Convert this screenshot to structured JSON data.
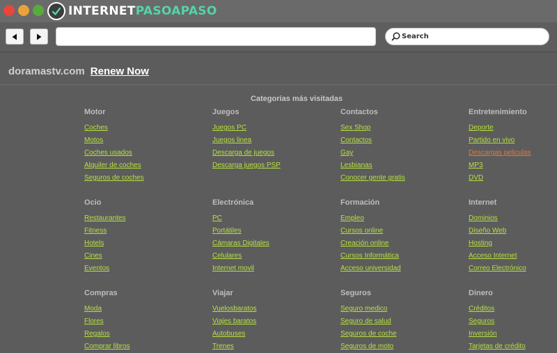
{
  "browser": {
    "brand_main": "INTERNET",
    "brand_accent": "PASOAPASO",
    "address_value": "",
    "search_placeholder": "Search"
  },
  "page": {
    "domain": "doramastv.com",
    "renew_label": "Renew Now",
    "categories_title": "Categorías más visitadas"
  },
  "colors": {
    "page_background": "#5c5c5c",
    "link": "#b7e23f",
    "link_visited": "#e07a3e",
    "heading": "#bdbdbd",
    "brand_accent": "#55d3a8",
    "traffic_red": "#e8453c",
    "traffic_yellow": "#e9a23b",
    "traffic_green": "#5aab3e"
  },
  "categories": [
    {
      "heading": "Motor",
      "links": [
        {
          "label": "Coches"
        },
        {
          "label": "Motos"
        },
        {
          "label": "Coches usados"
        },
        {
          "label": "Alquiler de coches"
        },
        {
          "label": "Seguros de coches"
        }
      ]
    },
    {
      "heading": "Juegos",
      "links": [
        {
          "label": "Juegos PC"
        },
        {
          "label": "Juegos linea"
        },
        {
          "label": "Descarga de juegos"
        },
        {
          "label": "Descarga juegos PSP"
        }
      ]
    },
    {
      "heading": "Contactos",
      "links": [
        {
          "label": "Sex Shop"
        },
        {
          "label": "Contactos"
        },
        {
          "label": "Gay"
        },
        {
          "label": "Lesbianas"
        },
        {
          "label": "Conocer gente gratis"
        }
      ]
    },
    {
      "heading": "Entretenimiento",
      "links": [
        {
          "label": "Deporte"
        },
        {
          "label": "Partido en vivo"
        },
        {
          "label": "Descargas peliculas",
          "visited": true
        },
        {
          "label": "MP3"
        },
        {
          "label": "DVD"
        }
      ]
    },
    {
      "heading": "Ocio",
      "links": [
        {
          "label": "Restaurantes"
        },
        {
          "label": "Fitness"
        },
        {
          "label": "Hotels"
        },
        {
          "label": "Cines"
        },
        {
          "label": "Eventos"
        }
      ]
    },
    {
      "heading": "Electrónica",
      "links": [
        {
          "label": "PC"
        },
        {
          "label": "Portátiles"
        },
        {
          "label": "Cámaras Digitales"
        },
        {
          "label": "Celulares"
        },
        {
          "label": "Internet movil"
        }
      ]
    },
    {
      "heading": "Formación",
      "links": [
        {
          "label": "Empleo"
        },
        {
          "label": "Cursos online"
        },
        {
          "label": "Creación online"
        },
        {
          "label": "Cursos Informática"
        },
        {
          "label": "Acceso universidad"
        }
      ]
    },
    {
      "heading": "Internet",
      "links": [
        {
          "label": "Dominios"
        },
        {
          "label": "Diseño Web"
        },
        {
          "label": "Hosting"
        },
        {
          "label": "Acceso Internet"
        },
        {
          "label": "Correo Electrónico"
        }
      ]
    },
    {
      "heading": "Compras",
      "links": [
        {
          "label": "Moda"
        },
        {
          "label": "Flores"
        },
        {
          "label": "Regalos"
        },
        {
          "label": "Comprar libros"
        }
      ]
    },
    {
      "heading": "Viajar",
      "links": [
        {
          "label": "Vuelosbaratos"
        },
        {
          "label": "Viajes baratos"
        },
        {
          "label": "Autobuses"
        },
        {
          "label": "Trenes"
        }
      ]
    },
    {
      "heading": "Seguros",
      "links": [
        {
          "label": "Seguro medico"
        },
        {
          "label": "Seguro de salud"
        },
        {
          "label": "Seguros de coche"
        },
        {
          "label": "Seguros de moto"
        }
      ]
    },
    {
      "heading": "Dinero",
      "links": [
        {
          "label": "Créditos"
        },
        {
          "label": "Seguros"
        },
        {
          "label": "Inversión"
        },
        {
          "label": "Tarjetas de crédito"
        }
      ]
    }
  ]
}
